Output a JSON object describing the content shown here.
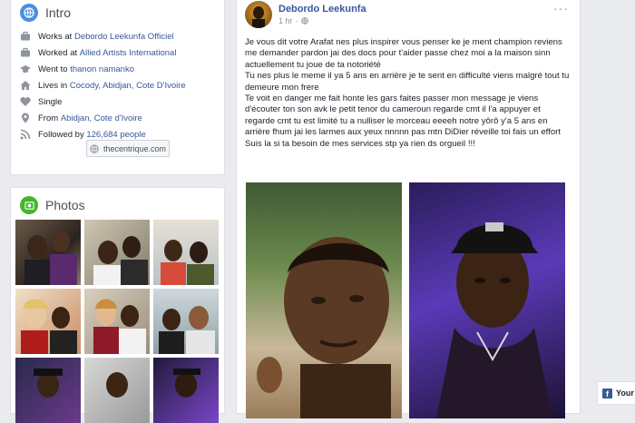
{
  "intro": {
    "title": "Intro",
    "rows": [
      {
        "icon": "briefcase-icon",
        "prefix": "Works at ",
        "link": "Debordo Leekunfa Officiel",
        "suffix": ""
      },
      {
        "icon": "briefcase-icon",
        "prefix": "Worked at ",
        "link": "Allied Artists International",
        "suffix": ""
      },
      {
        "icon": "graduation-cap-icon",
        "prefix": "Went to ",
        "link": "thanon namanko",
        "suffix": ""
      },
      {
        "icon": "home-icon",
        "prefix": "Lives in ",
        "link": "Cocody, Abidjan, Cote D'Ivoire",
        "suffix": ""
      },
      {
        "icon": "heart-icon",
        "prefix": "Single",
        "link": "",
        "suffix": ""
      },
      {
        "icon": "location-pin-icon",
        "prefix": "From ",
        "link": "Abidjan, Cote d'Ivoire",
        "suffix": ""
      },
      {
        "icon": "rss-icon",
        "prefix": "Followed by ",
        "link": "126,684 people",
        "suffix": ""
      }
    ],
    "website": "thecentrique.com"
  },
  "photos": {
    "title": "Photos"
  },
  "post": {
    "author": "Debordo Leekunfa",
    "time": "1 hr",
    "privacy_icon": "globe-icon",
    "menu": "···",
    "paragraphs": [
      "Je vous dit votre Arafat nes plus inspirer vous penser ke je ment champion reviens me demander pardon jai des docs pour t'aider passe chez moi a la maison sinn actuellement tu joue de ta notoriété",
      "Tu nes plus le meme il ya 5 ans en arrière je te sent en difficulté viens malgré tout tu demeure mon frere",
      "Te voit en danger me fait honte les gars faites passer mon message je viens d'écouter ton son avk le petit tenor du cameroun regarde cmt il l'a appuyer et regarde cmt tu est limité tu a nulliser le morceau eeeeh notre yôrô y'a 5 ans en arrière fhum jai les larmes aux yeux nnnnn pas mtn DiDier réveille toi fais un effort",
      "Suis la si ta besoin de mes services stp ya rien ds orgueil !!!"
    ]
  },
  "footer": {
    "label": "Your"
  },
  "colors": {
    "link": "#385898",
    "fb_blue": "#3b5998",
    "background": "#e9ebee"
  }
}
